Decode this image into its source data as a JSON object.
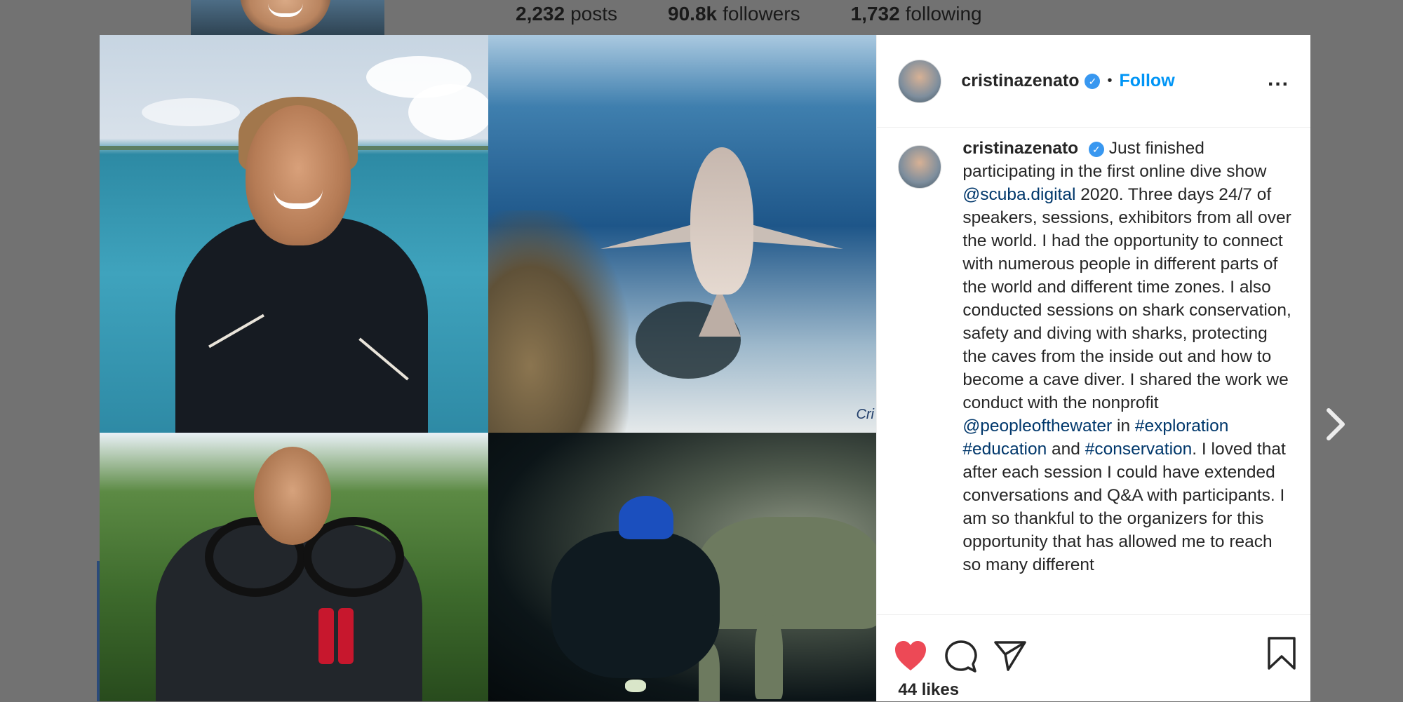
{
  "profile_stats": {
    "posts_count": "2,232",
    "posts_label": "posts",
    "followers_count": "90.8k",
    "followers_label": "followers",
    "following_count": "1,732",
    "following_label": "following"
  },
  "post": {
    "username": "cristinazenato",
    "follow_label": "Follow",
    "separator": "•",
    "more_label": "...",
    "photo_watermark": "Cri",
    "caption": {
      "username": "cristinazenato",
      "segments": [
        {
          "text": "Just finished participating in the first online dive show ",
          "type": "text"
        },
        {
          "text": "@scuba.digital",
          "type": "tag"
        },
        {
          "text": " 2020. Three days 24/7 of speakers, sessions, exhibitors from all over the world. I had the opportunity to connect with numerous people in different parts of the world and different time zones. I also conducted sessions on shark conservation, safety and diving with sharks, protecting the caves from the inside out and how to become a cave diver. I shared the work we conduct with the nonprofit ",
          "type": "text"
        },
        {
          "text": "@peopleofthewater",
          "type": "tag"
        },
        {
          "text": " in ",
          "type": "text"
        },
        {
          "text": "#exploration",
          "type": "tag"
        },
        {
          "text": " ",
          "type": "text"
        },
        {
          "text": "#education",
          "type": "tag"
        },
        {
          "text": " and ",
          "type": "text"
        },
        {
          "text": "#conservation",
          "type": "tag"
        },
        {
          "text": ". I loved that after each session I could have extended conversations and Q&A with participants. I am so thankful to the organizers for this opportunity that has allowed me to reach so many different",
          "type": "text"
        }
      ]
    },
    "likes_text": "44 likes",
    "liked": true,
    "icons": {
      "like": "heart-icon",
      "comment": "comment-icon",
      "share": "paper-plane-icon",
      "save": "bookmark-icon",
      "next": "chevron-right-icon",
      "verified": "verified-badge-icon"
    },
    "colors": {
      "like_red": "#ed4956",
      "follow_blue": "#0095f6",
      "tag_blue": "#00376b",
      "verified_blue": "#3897f0"
    }
  }
}
